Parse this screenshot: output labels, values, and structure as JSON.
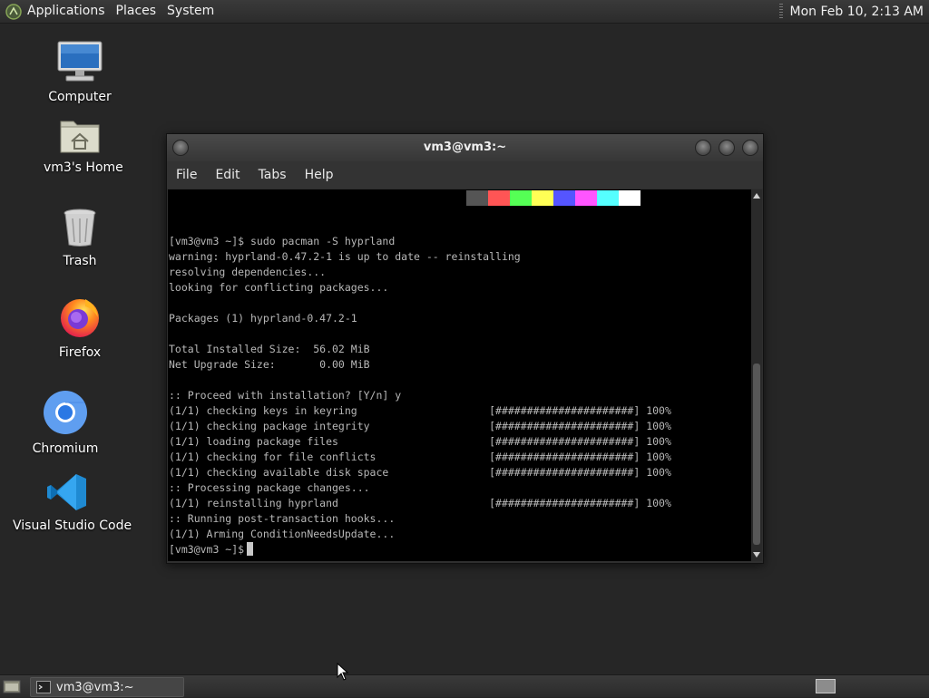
{
  "top_panel": {
    "menus": [
      "Applications",
      "Places",
      "System"
    ],
    "clock": "Mon Feb 10,  2:13 AM"
  },
  "desktop_icons": [
    {
      "label": "Computer",
      "icon": "computer-icon"
    },
    {
      "label": "vm3's Home",
      "icon": "home-folder-icon"
    },
    {
      "label": "Trash",
      "icon": "trash-icon"
    },
    {
      "label": "Firefox",
      "icon": "firefox-icon"
    },
    {
      "label": "Chromium",
      "icon": "chromium-icon"
    },
    {
      "label": "Visual Studio Code",
      "icon": "vscode-icon"
    }
  ],
  "terminal_window": {
    "title": "vm3@vm3:~",
    "menu": [
      "File",
      "Edit",
      "Tabs",
      "Help"
    ],
    "color_bar": [
      "#555555",
      "#ff5555",
      "#55ff55",
      "#ffff55",
      "#5555ff",
      "#ff55ff",
      "#55ffff",
      "#ffffff"
    ],
    "lines": [
      "[vm3@vm3 ~]$ sudo pacman -S hyprland",
      "warning: hyprland-0.47.2-1 is up to date -- reinstalling",
      "resolving dependencies...",
      "looking for conflicting packages...",
      "",
      "Packages (1) hyprland-0.47.2-1",
      "",
      "Total Installed Size:  56.02 MiB",
      "Net Upgrade Size:       0.00 MiB",
      "",
      ":: Proceed with installation? [Y/n] y",
      "(1/1) checking keys in keyring                     [######################] 100%",
      "(1/1) checking package integrity                   [######################] 100%",
      "(1/1) loading package files                        [######################] 100%",
      "(1/1) checking for file conflicts                  [######################] 100%",
      "(1/1) checking available disk space                [######################] 100%",
      ":: Processing package changes...",
      "(1/1) reinstalling hyprland                        [######################] 100%",
      ":: Running post-transaction hooks...",
      "(1/1) Arming ConditionNeedsUpdate..."
    ],
    "prompt": "[vm3@vm3 ~]$"
  },
  "taskbar": {
    "task_label": "vm3@vm3:~"
  }
}
